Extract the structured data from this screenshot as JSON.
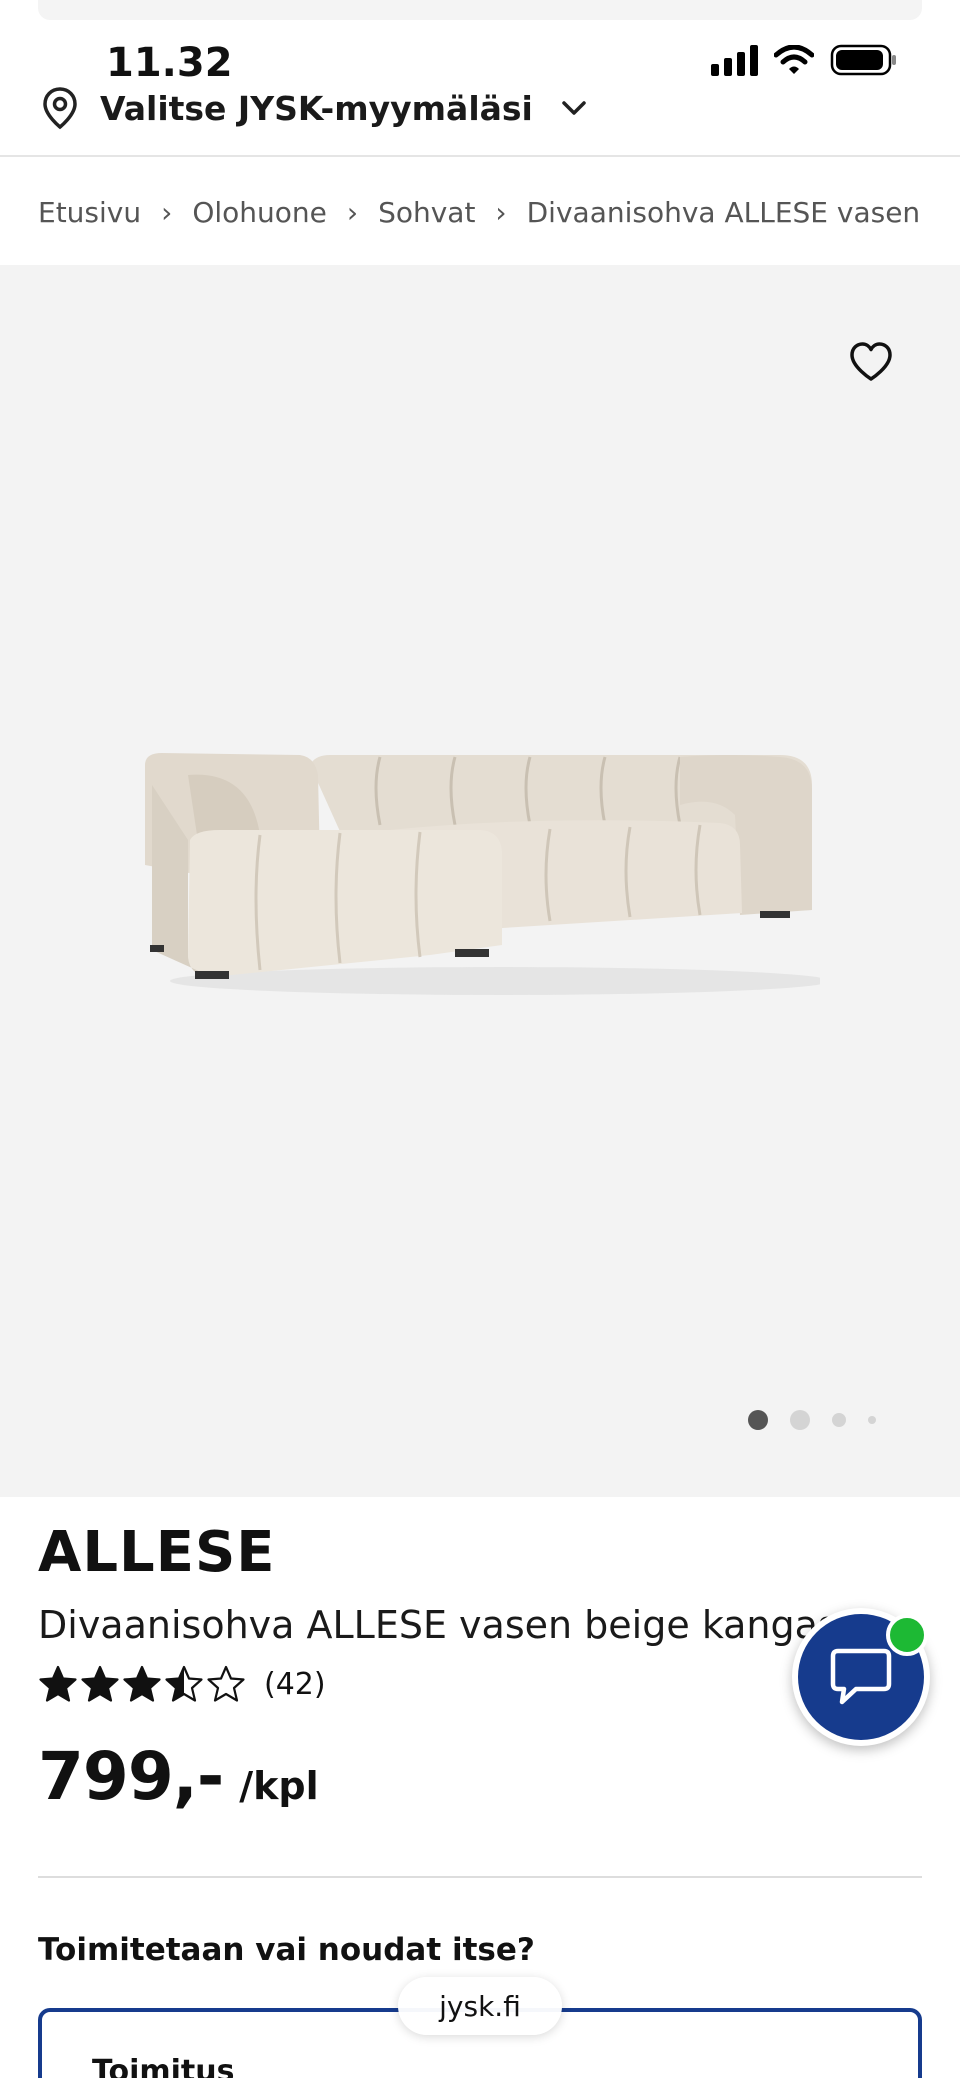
{
  "status_bar": {
    "time": "11.32"
  },
  "header": {
    "store_selector_label": "Valitse JYSK-myymäläsi"
  },
  "breadcrumb": {
    "items": [
      "Etusivu",
      "Olohuone",
      "Sohvat",
      "Divaanisohva ALLESE vasen b"
    ],
    "separator": "›"
  },
  "gallery": {
    "page_count": 4,
    "active_index": 0
  },
  "product": {
    "brand": "ALLESE",
    "name": "Divaanisohva ALLESE vasen beige kangas",
    "rating": 3.5,
    "rating_max": 5,
    "review_count": "(42)",
    "price": "799,-",
    "unit": "/kpl"
  },
  "delivery": {
    "question": "Toimitetaan vai noudat itse?",
    "option_label": "Toimitus"
  },
  "browser": {
    "url": "jysk.fi"
  },
  "colors": {
    "brand_blue": "#163b8d",
    "online_green": "#1db934",
    "hero_bg": "#f3f3f3"
  },
  "icons": [
    "location-pin-icon",
    "chevron-down-icon",
    "heart-icon",
    "chat-bubble-icon",
    "star-icon",
    "signal-icon",
    "wifi-icon",
    "battery-icon"
  ]
}
